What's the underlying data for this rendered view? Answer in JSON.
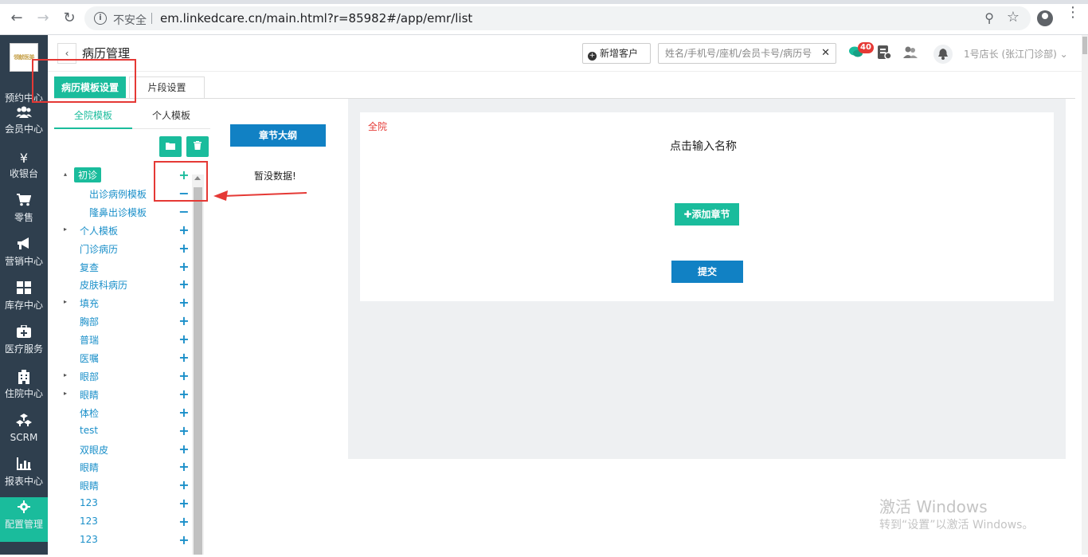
{
  "browser": {
    "insecure_label": "不安全",
    "url": "em.linkedcare.cn/main.html?r=85982#/app/emr/list"
  },
  "leftnav": {
    "logo_text": "领献医美",
    "items": [
      {
        "label": "预约中心",
        "icon": "calendar-icon"
      },
      {
        "label": "会员中心",
        "icon": "users-icon"
      },
      {
        "label": "收银台",
        "icon": "yen-icon",
        "glyph": "¥"
      },
      {
        "label": "零售",
        "icon": "cart-icon"
      },
      {
        "label": "营销中心",
        "icon": "megaphone-icon"
      },
      {
        "label": "库存中心",
        "icon": "grid-icon"
      },
      {
        "label": "医疗服务",
        "icon": "medkit-icon"
      },
      {
        "label": "住院中心",
        "icon": "hospital-icon"
      },
      {
        "label": "SCRM",
        "icon": "cubes-icon"
      },
      {
        "label": "报表中心",
        "icon": "bar-chart-icon"
      },
      {
        "label": "配置管理",
        "icon": "gear-icon"
      }
    ]
  },
  "header": {
    "title": "病历管理",
    "add_customer": "新增客户",
    "search_placeholder": "姓名/手机号/座机/会员卡号/病历号",
    "badge_count": "40",
    "user": "1号店长 (张江门诊部)"
  },
  "tabs": {
    "template_settings": "病历模板设置",
    "snippet_settings": "片段设置"
  },
  "tree_panel": {
    "tab_all": "全院模板",
    "tab_personal": "个人模板",
    "items": [
      {
        "label": "初诊",
        "level": 0,
        "caret": "▴",
        "selected": true,
        "action": "+"
      },
      {
        "label": "出诊病例模板",
        "level": 1,
        "caret": "",
        "selected": false,
        "action": "−"
      },
      {
        "label": "隆鼻出诊模板",
        "level": 1,
        "caret": "",
        "selected": false,
        "action": "−"
      },
      {
        "label": "个人模板",
        "level": 0,
        "caret": "▸",
        "selected": false,
        "action": "+"
      },
      {
        "label": "门诊病历",
        "level": 0,
        "caret": "",
        "selected": false,
        "action": "+"
      },
      {
        "label": "复查",
        "level": 0,
        "caret": "",
        "selected": false,
        "action": "+"
      },
      {
        "label": "皮肤科病历",
        "level": 0,
        "caret": "",
        "selected": false,
        "action": "+"
      },
      {
        "label": "填充",
        "level": 0,
        "caret": "▸",
        "selected": false,
        "action": "+"
      },
      {
        "label": "胸部",
        "level": 0,
        "caret": "",
        "selected": false,
        "action": "+"
      },
      {
        "label": "普瑞",
        "level": 0,
        "caret": "",
        "selected": false,
        "action": "+"
      },
      {
        "label": "医嘱",
        "level": 0,
        "caret": "",
        "selected": false,
        "action": "+"
      },
      {
        "label": "眼部",
        "level": 0,
        "caret": "▸",
        "selected": false,
        "action": "+"
      },
      {
        "label": "眼睛",
        "level": 0,
        "caret": "▸",
        "selected": false,
        "action": "+"
      },
      {
        "label": "体检",
        "level": 0,
        "caret": "",
        "selected": false,
        "action": "+"
      },
      {
        "label": "test",
        "level": 0,
        "caret": "",
        "selected": false,
        "action": "+"
      },
      {
        "label": "双眼皮",
        "level": 0,
        "caret": "",
        "selected": false,
        "action": "+"
      },
      {
        "label": "眼睛",
        "level": 0,
        "caret": "",
        "selected": false,
        "action": "+"
      },
      {
        "label": "眼睛",
        "level": 0,
        "caret": "",
        "selected": false,
        "action": "+"
      },
      {
        "label": "123",
        "level": 0,
        "caret": "",
        "selected": false,
        "action": "+"
      },
      {
        "label": "123",
        "level": 0,
        "caret": "",
        "selected": false,
        "action": "+"
      },
      {
        "label": "123",
        "level": 0,
        "caret": "",
        "selected": false,
        "action": "+"
      }
    ]
  },
  "outline": {
    "title": "章节大纲",
    "empty": "暂没数据!"
  },
  "editor": {
    "scope": "全院",
    "name_placeholder": "点击输入名称",
    "add_section": "添加章节",
    "submit": "提交"
  },
  "watermark": {
    "line1": "激活 Windows",
    "line2": "转到“设置”以激活 Windows。"
  },
  "colors": {
    "accent": "#1abc9c",
    "primary": "#1181c4",
    "nav_bg": "#2f3f4e",
    "annotation_red": "#e53935"
  }
}
